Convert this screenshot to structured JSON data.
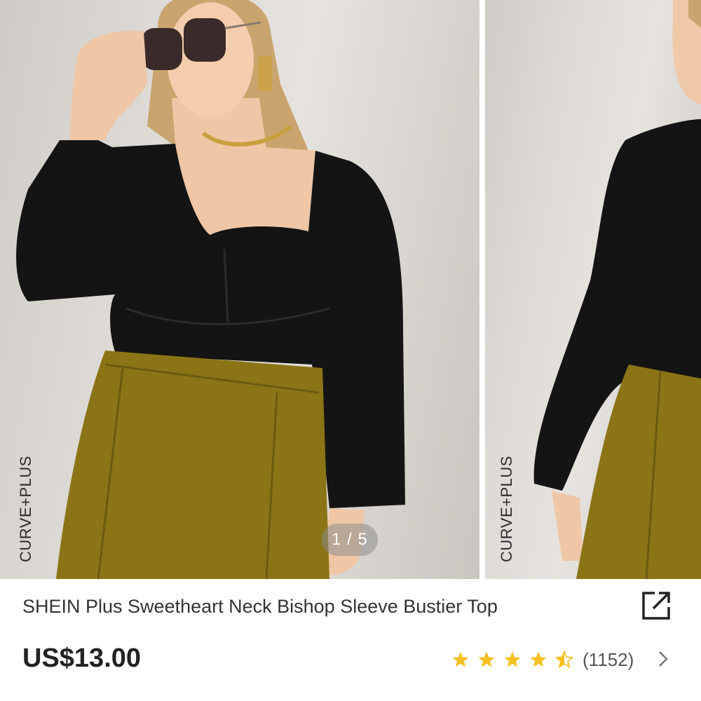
{
  "gallery": {
    "brand_tag": "CURVE+PLUS",
    "counter": "1 / 5",
    "images": [
      {
        "icon": "model-front-photo"
      },
      {
        "icon": "model-back-photo"
      }
    ]
  },
  "product": {
    "title": "SHEIN Plus Sweetheart Neck Bishop Sleeve Bustier Top",
    "price": "US$13.00",
    "rating_stars": 4.5,
    "review_count": "(1152)",
    "share_icon": "share-icon",
    "reviews_icon": "chevron-right-icon"
  },
  "colors": {
    "star": "#f6c022",
    "text": "#333333",
    "price": "#222222",
    "top": "#141414",
    "skirt": "#8b7416"
  }
}
